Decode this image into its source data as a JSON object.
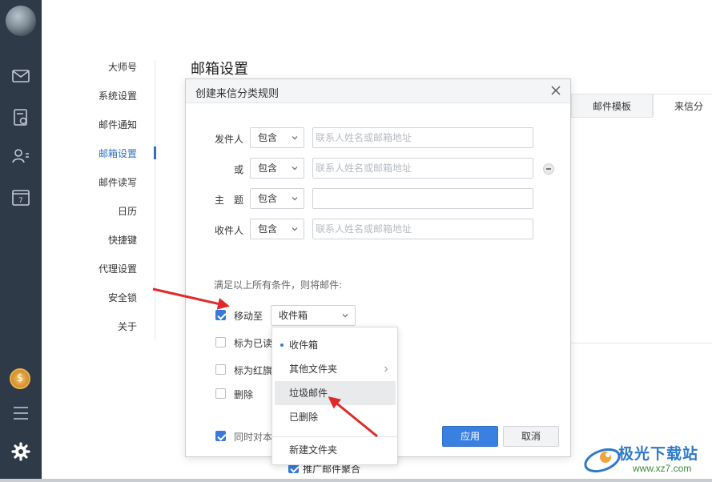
{
  "sidebar": {
    "icons": [
      "mail-icon",
      "contacts-doc-icon",
      "address-book-icon",
      "calendar-icon",
      "coin-icon",
      "menu-icon",
      "gear-icon"
    ]
  },
  "settings_nav": {
    "items": [
      "大师号",
      "系统设置",
      "邮件通知",
      "邮箱设置",
      "邮件读写",
      "日历",
      "快捷键",
      "代理设置",
      "安全锁",
      "关于"
    ],
    "active": "邮箱设置"
  },
  "page": {
    "title": "邮箱设置",
    "tabs": [
      "邮件模板",
      "来信分"
    ]
  },
  "dialog": {
    "title": "创建来信分类规则",
    "conditions": [
      {
        "label": "发件人",
        "operator": "包含",
        "value": "",
        "placeholder": "联系人姓名或邮箱地址"
      },
      {
        "label": "或",
        "operator": "包含",
        "value": "",
        "placeholder": "联系人姓名或邮箱地址"
      },
      {
        "label": "主　题",
        "operator": "包含",
        "value": "",
        "placeholder": ""
      },
      {
        "label": "收件人",
        "operator": "包含",
        "value": "",
        "placeholder": "联系人姓名或邮箱地址"
      }
    ],
    "hint": "满足以上所有条件，则将邮件:",
    "actions": {
      "move_to": {
        "label": "移动至",
        "checked": true,
        "selected": "收件箱"
      },
      "mark_read": {
        "label": "标为已读",
        "checked": false
      },
      "mark_flag": {
        "label": "标为红旗",
        "checked": false
      },
      "delete": {
        "label": "删除",
        "checked": false
      },
      "apply_existing": {
        "label": "同时对本",
        "checked": true
      }
    },
    "apply_label": "应用",
    "cancel_label": "取消"
  },
  "dropdown": {
    "items": [
      "收件箱",
      "其他文件夹",
      "垃圾邮件",
      "已删除",
      "新建文件夹"
    ],
    "selected": "收件箱",
    "hovered": "垃圾邮件"
  },
  "background": {
    "bottom_checkbox_label": "推广邮件聚合"
  },
  "watermark": {
    "text": "极光下载站",
    "url": "www.xz7.com"
  },
  "colors": {
    "accent": "#3a80e0",
    "rail": "#2f3a48",
    "annotation_arrow": "#e02a2a"
  }
}
